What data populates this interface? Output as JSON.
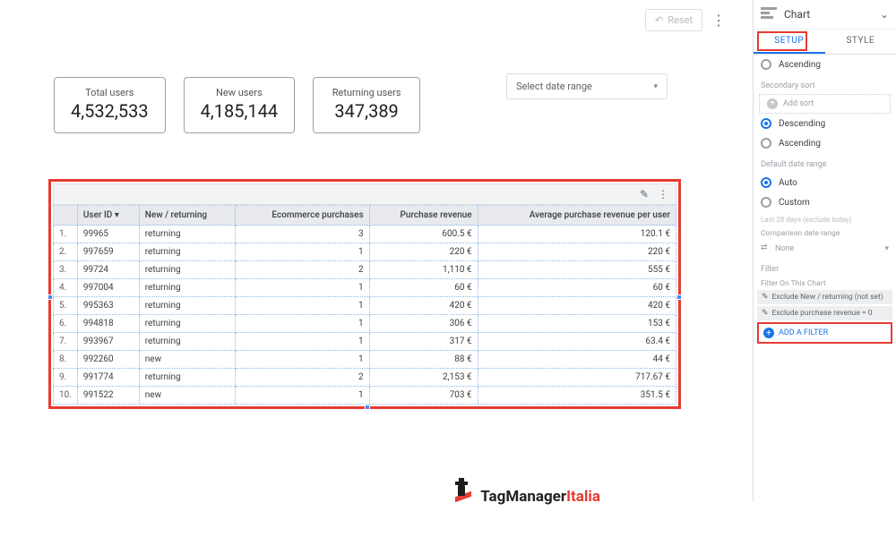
{
  "toolbar": {
    "reset": "Reset"
  },
  "cards": [
    {
      "label": "Total users",
      "value": "4,532,533"
    },
    {
      "label": "New users",
      "value": "4,185,144"
    },
    {
      "label": "Returning users",
      "value": "347,389"
    }
  ],
  "daterange_label": "Select date range",
  "table": {
    "headers": [
      "User ID",
      "New / returning",
      "Ecommerce purchases",
      "Purchase revenue",
      "Average purchase revenue per user"
    ],
    "rows": [
      {
        "idx": "1.",
        "id": "99965",
        "nr": "returning",
        "pur": "3",
        "rev": "600.5 €",
        "avg": "120.1 €"
      },
      {
        "idx": "2.",
        "id": "997659",
        "nr": "returning",
        "pur": "1",
        "rev": "220 €",
        "avg": "220 €"
      },
      {
        "idx": "3.",
        "id": "99724",
        "nr": "returning",
        "pur": "2",
        "rev": "1,110 €",
        "avg": "555 €"
      },
      {
        "idx": "4.",
        "id": "997004",
        "nr": "returning",
        "pur": "1",
        "rev": "60 €",
        "avg": "60 €"
      },
      {
        "idx": "5.",
        "id": "995363",
        "nr": "returning",
        "pur": "1",
        "rev": "420 €",
        "avg": "420 €"
      },
      {
        "idx": "6.",
        "id": "994818",
        "nr": "returning",
        "pur": "1",
        "rev": "306 €",
        "avg": "153 €"
      },
      {
        "idx": "7.",
        "id": "993967",
        "nr": "returning",
        "pur": "1",
        "rev": "317 €",
        "avg": "63.4 €"
      },
      {
        "idx": "8.",
        "id": "992260",
        "nr": "new",
        "pur": "1",
        "rev": "88 €",
        "avg": "44 €"
      },
      {
        "idx": "9.",
        "id": "991774",
        "nr": "returning",
        "pur": "2",
        "rev": "2,153 €",
        "avg": "717.67 €"
      },
      {
        "idx": "10.",
        "id": "991522",
        "nr": "new",
        "pur": "1",
        "rev": "703 €",
        "avg": "351.5 €"
      }
    ]
  },
  "panel": {
    "title": "Chart",
    "tabs": {
      "setup": "SETUP",
      "style": "STYLE"
    },
    "ascending": "Ascending",
    "descending": "Descending",
    "secondary_sort": "Secondary sort",
    "add_sort": "Add sort",
    "default_date_range": "Default date range",
    "auto": "Auto",
    "custom": "Custom",
    "last28": "Last 28 days (exclude today)",
    "comparison": "Comparison date range",
    "none": "None",
    "filter": "Filter",
    "filter_on_chart": "Filter On This Chart",
    "f1": "Exclude New / returning (not set)",
    "f2": "Exclude purchase revenue = 0",
    "add_filter": "ADD A FILTER"
  },
  "logo": {
    "brand": "TagManager",
    "country": "Italia"
  }
}
